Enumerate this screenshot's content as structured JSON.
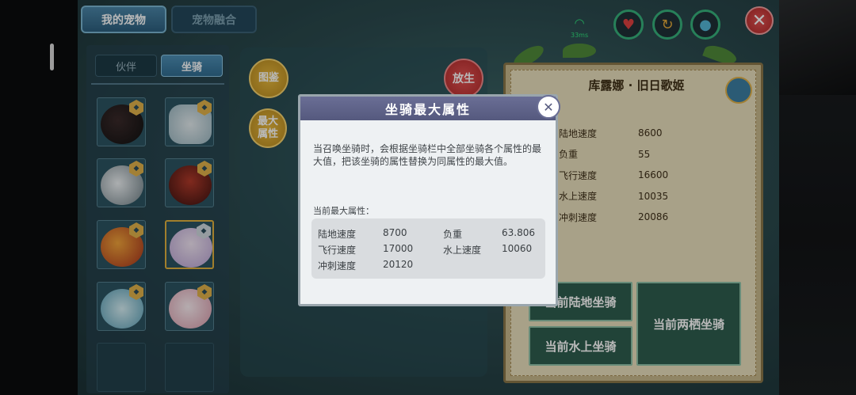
{
  "header": {
    "tab_my_pets": "我的宠物",
    "tab_pet_fusion": "宠物融合"
  },
  "left_panel": {
    "seg_partner": "伙伴",
    "seg_mount": "坐骑"
  },
  "middle": {
    "btn_atlas": "图鉴",
    "btn_max_attr": "最大属性",
    "btn_release": "放生"
  },
  "hud": {
    "ping": "33ms",
    "icons": [
      "heart-icon",
      "buff-icon",
      "water-drop-icon"
    ]
  },
  "card": {
    "title": "库露娜 · 旧日歌姬",
    "stats": [
      {
        "label": "陆地速度",
        "value": "8600"
      },
      {
        "label": "负重",
        "value": "55"
      },
      {
        "label": "飞行速度",
        "value": "16600"
      },
      {
        "label": "水上速度",
        "value": "10035"
      },
      {
        "label": "冲刺速度",
        "value": "20086"
      }
    ],
    "btn_land": "当前陆地坐骑",
    "btn_water": "当前水上坐骑",
    "btn_amphibious": "当前两栖坐骑"
  },
  "modal": {
    "title": "坐骑最大属性",
    "description": "当召唤坐骑时，会根据坐骑栏中全部坐骑各个属性的最大值，把该坐骑的属性替换为同属性的最大值。",
    "subtitle": "当前最大属性：",
    "stats": [
      {
        "label": "陆地速度",
        "value": "8700"
      },
      {
        "label": "负重",
        "value": "63.806"
      },
      {
        "label": "飞行速度",
        "value": "17000"
      },
      {
        "label": "水上速度",
        "value": "10060"
      },
      {
        "label": "冲刺速度",
        "value": "20120"
      }
    ]
  },
  "colors": {
    "accent_gold": "#e1b24a",
    "modal_header": "#5f6389",
    "mode_button": "#2f5e4e",
    "close_red": "#c83434"
  }
}
